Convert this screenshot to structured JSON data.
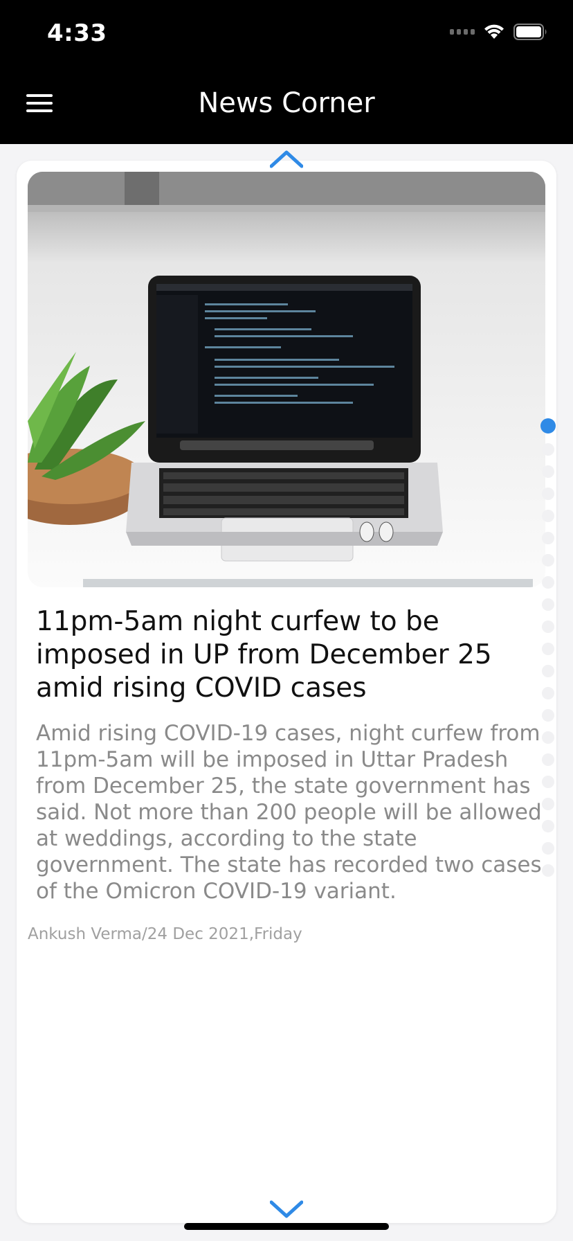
{
  "status_bar": {
    "time": "4:33"
  },
  "app_bar": {
    "title": "News Corner",
    "menu_icon": "hamburger-menu-icon"
  },
  "article": {
    "image_alt": "laptop-with-code-and-plant",
    "headline": "11pm-5am night curfew to be imposed in UP from December 25 amid rising COVID cases",
    "summary": "Amid rising COVID-19 cases, night curfew from 11pm-5am will be imposed in Uttar Pradesh from December 25, the state government has said. Not more than 200 people will be allowed at weddings, according to the state government. The state has recorded two cases of the Omicron COVID-19 variant.",
    "byline": "Ankush Verma/24 Dec 2021,Friday"
  },
  "navigation": {
    "prev_icon": "chevron-up-icon",
    "next_icon": "chevron-down-icon"
  },
  "pager": {
    "total": 21,
    "active_index": 0
  },
  "colors": {
    "accent": "#2f8ae6",
    "app_bar": "#000000"
  }
}
